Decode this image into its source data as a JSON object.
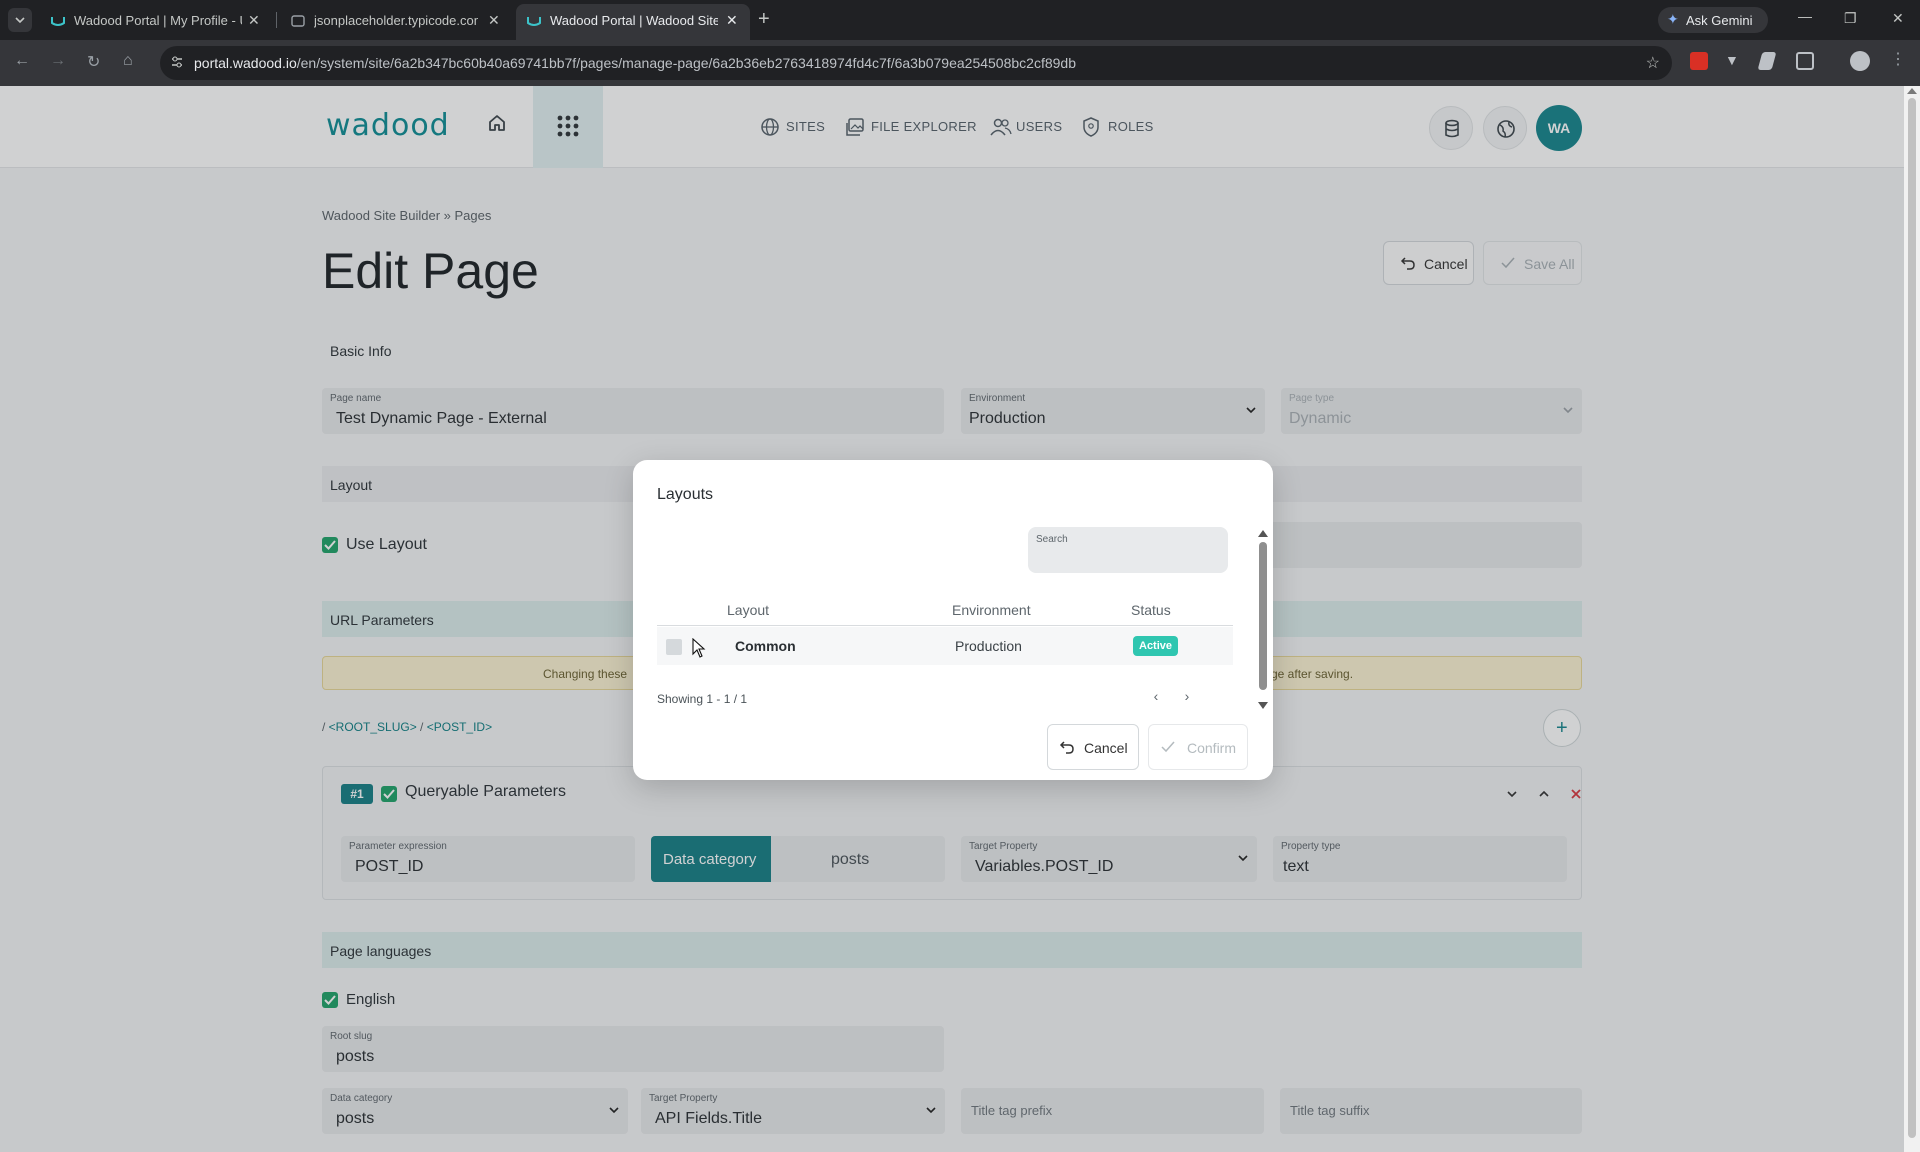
{
  "browser": {
    "tabs": [
      {
        "title": "Wadood Portal | My Profile - U",
        "active": false
      },
      {
        "title": "jsonplaceholder.typicode.com/",
        "active": false
      },
      {
        "title": "Wadood Portal | Wadood Site B",
        "active": true
      }
    ],
    "gemini_label": "Ask Gemini",
    "url_host": "portal.wadood.io",
    "url_path": "/en/system/site/6a2b347bc60b40a69741bb7f/pages/manage-page/6a2b36eb2763418974fd4c7f/6a3b079ea254508bc2cf89db"
  },
  "header": {
    "logo_text": "wadood",
    "nav": [
      {
        "label": "SITES",
        "icon": "globe-icon"
      },
      {
        "label": "FILE EXPLORER",
        "icon": "images-icon"
      },
      {
        "label": "USERS",
        "icon": "users-icon"
      },
      {
        "label": "ROLES",
        "icon": "shield-icon"
      }
    ],
    "avatar_initials": "WA"
  },
  "page": {
    "breadcrumb": "Wadood Site Builder  » Pages",
    "title": "Edit Page",
    "cancel_label": "Cancel",
    "save_all_label": "Save All"
  },
  "basic_info": {
    "section_label": "Basic Info",
    "page_name_label": "Page name",
    "page_name_value": "Test Dynamic Page - External",
    "environment_label": "Environment",
    "environment_value": "Production",
    "page_type_label": "Page type",
    "page_type_value": "Dynamic"
  },
  "layout_section": {
    "section_label": "Layout",
    "use_layout_label": "Use Layout",
    "use_layout_checked": true
  },
  "url_parameters": {
    "section_label": "URL Parameters",
    "warning_start": "Changing these",
    "warning_end": "ge after saving.",
    "slug_root": "<ROOT_SLUG>",
    "slug_post": "<POST_ID>"
  },
  "param_card": {
    "number": "#1",
    "title": "Queryable Parameters",
    "expression_label": "Parameter expression",
    "expression_value": "POST_ID",
    "data_category_button": "Data category",
    "data_category_value": "posts",
    "target_property_label": "Target Property",
    "target_property_value": "Variables.POST_ID",
    "property_type_label": "Property type",
    "property_type_value": "text"
  },
  "languages": {
    "section_label": "Page languages",
    "english_label": "English",
    "root_slug_label": "Root slug",
    "root_slug_value": "posts",
    "data_category_label": "Data category",
    "data_category_value": "posts",
    "target_property_label": "Target Property",
    "target_property_value": "API Fields.Title",
    "title_prefix_placeholder": "Title tag prefix",
    "title_suffix_placeholder": "Title tag suffix"
  },
  "modal": {
    "title": "Layouts",
    "search_label": "Search",
    "columns": [
      "Layout",
      "Environment",
      "Status"
    ],
    "rows": [
      {
        "layout": "Common",
        "environment": "Production",
        "status": "Active"
      }
    ],
    "showing": "Showing 1 - 1 / 1",
    "cancel_label": "Cancel",
    "confirm_label": "Confirm"
  },
  "colors": {
    "brand": "#0f8e95",
    "active_badge": "#2fc6b0",
    "check": "#1fa36a"
  }
}
